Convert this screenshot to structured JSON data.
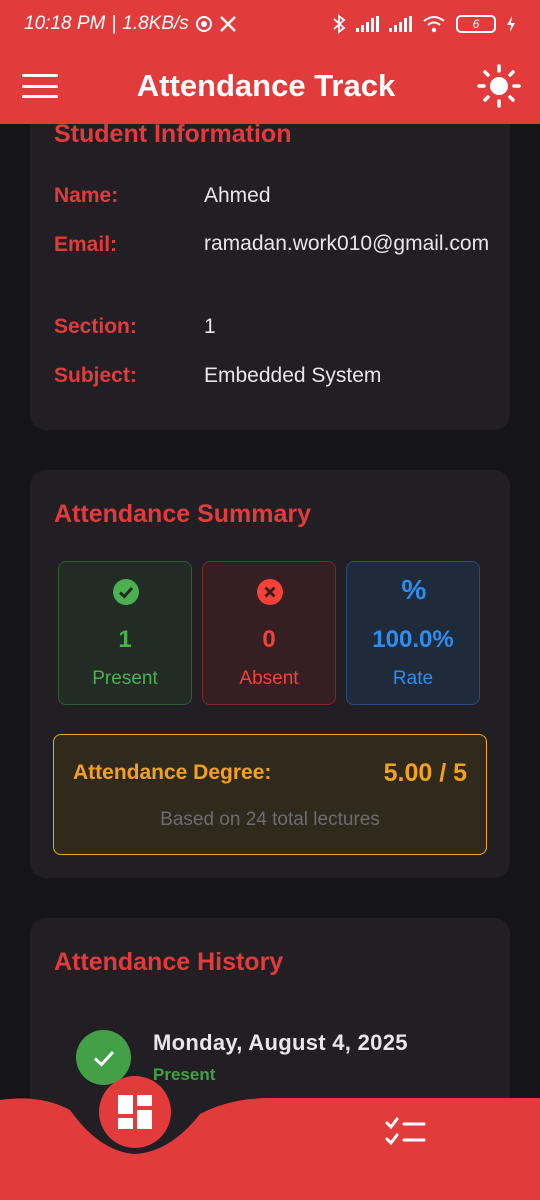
{
  "status_bar": {
    "time": "10:18 PM",
    "speed": "1.8KB/s",
    "battery": "6"
  },
  "app_bar": {
    "title": "Attendance Track"
  },
  "student_info": {
    "title": "Student Information",
    "rows": [
      {
        "label": "Name:",
        "value": "Ahmed"
      },
      {
        "label": "Email:",
        "value": "ramadan.work010@gmail.com"
      },
      {
        "label": "Section:",
        "value": "1"
      },
      {
        "label": "Subject:",
        "value": "Embedded System"
      }
    ]
  },
  "summary": {
    "title": "Attendance Summary",
    "present": {
      "value": "1",
      "label": "Present"
    },
    "absent": {
      "value": "0",
      "label": "Absent"
    },
    "rate": {
      "value": "100.0%",
      "label": "Rate",
      "icon_text": "%"
    },
    "degree_label": "Attendance Degree:",
    "degree_value": "5.00 / 5",
    "degree_note": "Based on 24 total lectures"
  },
  "history": {
    "title": "Attendance History",
    "items": [
      {
        "date": "Monday, August 4, 2025",
        "status": "Present"
      }
    ]
  },
  "colors": {
    "accent": "#e23b3c",
    "present": "#4caf50",
    "absent": "#f44336",
    "rate": "#2d8ef0",
    "degree": "#f5a21a"
  }
}
